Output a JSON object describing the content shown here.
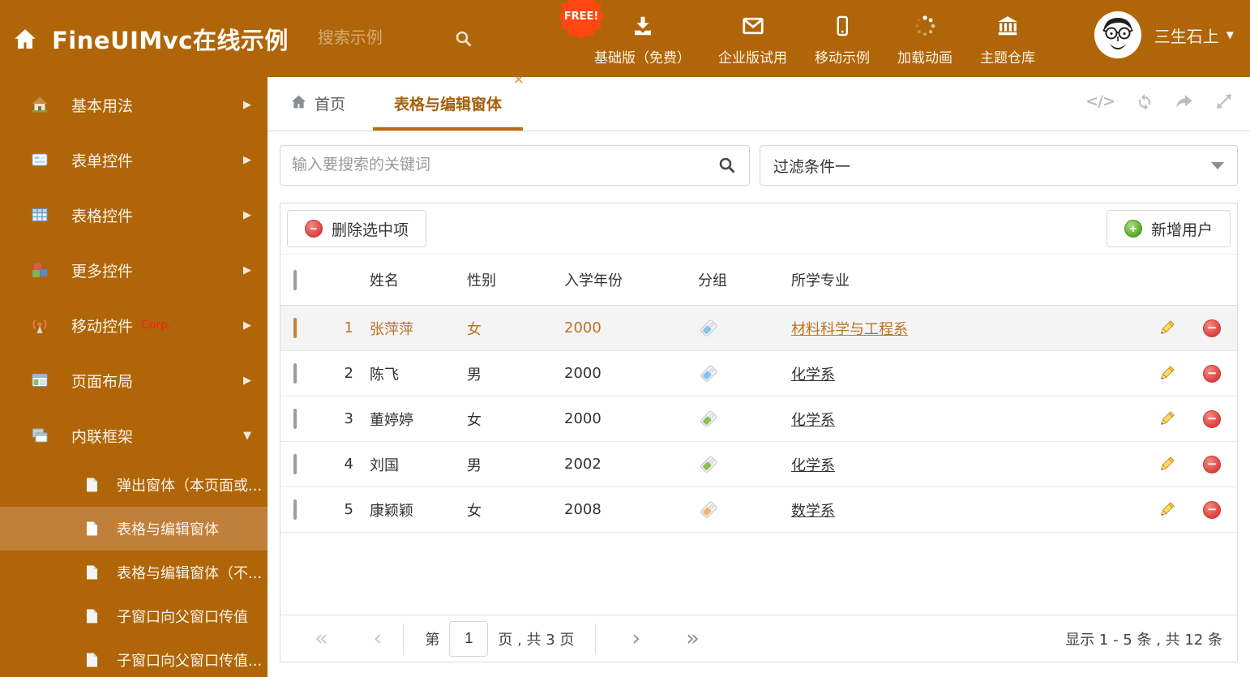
{
  "colors": {
    "theme_orange": "#B06508",
    "sidebar_active_bg": "#C1803A",
    "active_tab_text": "#A4610E",
    "highlight_row_text": "#B97423",
    "free_badge_bg": "#FF4712",
    "tag_blue": "#85C2EE",
    "tag_green": "#8CC152",
    "tag_orange": "#F6B26B"
  },
  "icons": {
    "chevron_right": "▶",
    "chevron_down": "▼",
    "caret_down": "▼",
    "close": "×",
    "code": "</>",
    "minus": "−",
    "plus": "+",
    "first": "«",
    "prev": "‹",
    "next": "›",
    "last": "»"
  },
  "header": {
    "title": "FineUIMvc在线示例",
    "search_placeholder": "搜索示例",
    "free_badge": "FREE!",
    "nav": [
      {
        "label": "基础版（免费）"
      },
      {
        "label": "企业版试用"
      },
      {
        "label": "移动示例"
      },
      {
        "label": "加载动画"
      },
      {
        "label": "主题仓库"
      }
    ],
    "user": "三生石上"
  },
  "sidebar": {
    "items": [
      {
        "label": "基本用法"
      },
      {
        "label": "表单控件"
      },
      {
        "label": "表格控件"
      },
      {
        "label": "更多控件"
      },
      {
        "label": "移动控件",
        "badge": "Corp."
      },
      {
        "label": "页面布局"
      },
      {
        "label": "内联框架"
      }
    ],
    "subitems": [
      {
        "label": "弹出窗体（本页面或..."
      },
      {
        "label": "表格与编辑窗体"
      },
      {
        "label": "表格与编辑窗体（不..."
      },
      {
        "label": "子窗口向父窗口传值"
      },
      {
        "label": "子窗口向父窗口传值..."
      }
    ]
  },
  "tabs": {
    "home": "首页",
    "active": "表格与编辑窗体"
  },
  "filter": {
    "search_placeholder": "输入要搜索的关键词",
    "dropdown_value": "过滤条件一"
  },
  "toolbar": {
    "delete_label": "删除选中项",
    "add_label": "新增用户"
  },
  "table": {
    "headers": {
      "name": "姓名",
      "gender": "性别",
      "year": "入学年份",
      "group": "分组",
      "major": "所学专业"
    },
    "rows": [
      {
        "index": "1",
        "name": "张萍萍",
        "gender": "女",
        "year": "2000",
        "tag_color": "#85C2EE",
        "major": "材料科学与工程系"
      },
      {
        "index": "2",
        "name": "陈飞",
        "gender": "男",
        "year": "2000",
        "tag_color": "#85C2EE",
        "major": "化学系"
      },
      {
        "index": "3",
        "name": "董婷婷",
        "gender": "女",
        "year": "2000",
        "tag_color": "#8CC152",
        "major": "化学系"
      },
      {
        "index": "4",
        "name": "刘国",
        "gender": "男",
        "year": "2002",
        "tag_color": "#8CC152",
        "major": "化学系"
      },
      {
        "index": "5",
        "name": "康颖颖",
        "gender": "女",
        "year": "2008",
        "tag_color": "#F6B26B",
        "major": "数学系"
      }
    ]
  },
  "pagination": {
    "page_prefix": "第",
    "page_value": "1",
    "page_suffix": "页 , 共 3 页",
    "summary": "显示 1 - 5 条 , 共 12 条"
  }
}
